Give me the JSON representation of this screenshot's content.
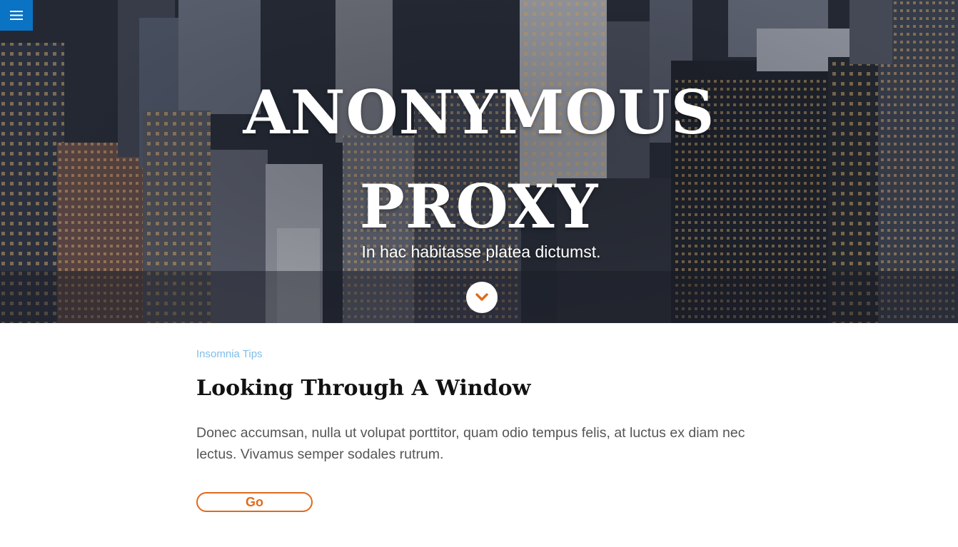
{
  "nav": {
    "menu_icon": "hamburger-menu-icon",
    "menu_color": "#0a73c4"
  },
  "hero": {
    "title_line1": "ANONYMOUS",
    "title_line2": "PROXY",
    "subtitle": "In hac habitasse platea dictumst.",
    "scroll_icon": "chevron-down-icon",
    "accent_color": "#e06a1b"
  },
  "post": {
    "category": "Insomnia Tips",
    "title": "Looking Through A Window",
    "body": "Donec accumsan, nulla ut volupat porttitor, quam odio tempus felis, at luctus ex diam nec lectus. Vivamus semper sodales rutrum.",
    "button_label": "Go"
  }
}
